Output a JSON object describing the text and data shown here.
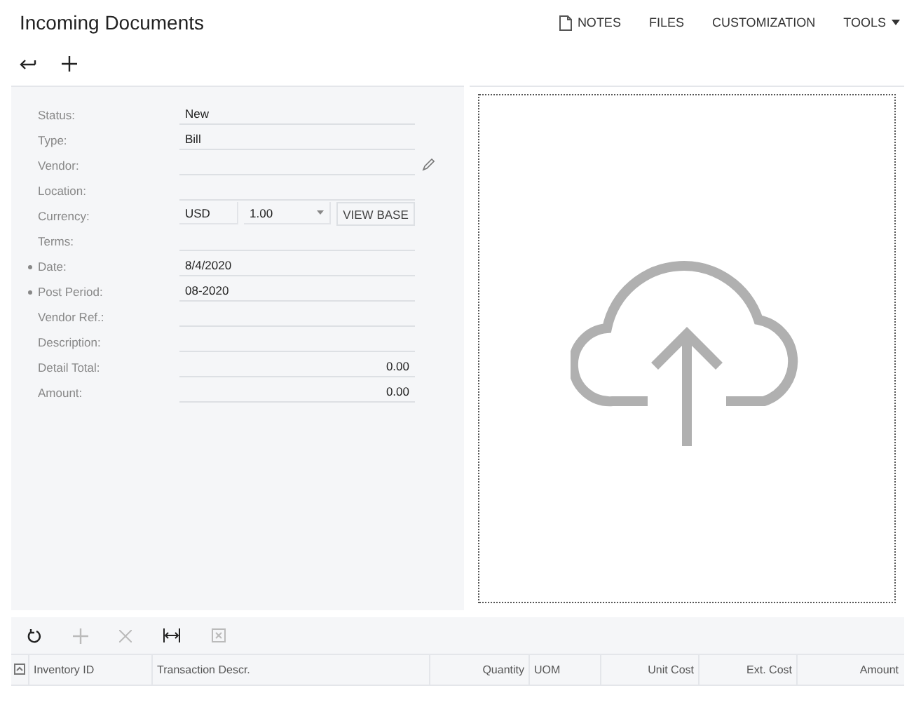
{
  "header": {
    "title": "Incoming Documents",
    "actions": [
      {
        "label": "NOTES",
        "kind": "notes"
      },
      {
        "label": "FILES",
        "kind": "plain"
      },
      {
        "label": "CUSTOMIZATION",
        "kind": "plain"
      },
      {
        "label": "TOOLS",
        "kind": "menu"
      }
    ]
  },
  "toolbar": [
    {
      "kind": "back"
    },
    {
      "kind": "add"
    }
  ],
  "form": [
    {
      "label": "Status:",
      "value": "New",
      "kind": "text",
      "required": false
    },
    {
      "label": "Type:",
      "value": "Bill",
      "kind": "text",
      "required": false
    },
    {
      "label": "Vendor:",
      "kind": "edit",
      "required": false
    },
    {
      "label": "Location:",
      "kind": "text",
      "required": false
    },
    {
      "label": "Currency:",
      "kind": "currency",
      "value": "USD",
      "rate": "1.00",
      "button": "VIEW BASE",
      "required": false
    },
    {
      "label": "Terms:",
      "kind": "text",
      "required": false
    },
    {
      "label": "Date:",
      "value": "8/4/2020",
      "kind": "text",
      "required": true
    },
    {
      "label": "Post Period:",
      "value": "08-2020",
      "kind": "text",
      "required": true
    },
    {
      "label": "Vendor Ref.:",
      "kind": "text",
      "required": false
    },
    {
      "label": "Description:",
      "kind": "text",
      "required": false
    },
    {
      "label": "Detail Total:",
      "value": "0.00",
      "kind": "amount",
      "required": false
    },
    {
      "label": "Amount:",
      "value": "0.00",
      "kind": "amount",
      "required": false
    }
  ],
  "grid": {
    "tools": [
      {
        "kind": "refresh",
        "disabled": false
      },
      {
        "kind": "add",
        "disabled": true
      },
      {
        "kind": "delete",
        "disabled": true
      },
      {
        "kind": "fit",
        "disabled": false
      },
      {
        "kind": "excel",
        "disabled": true
      }
    ],
    "columns": [
      {
        "label": "Inventory ID",
        "kind": "text"
      },
      {
        "label": "Transaction Descr.",
        "kind": "text"
      },
      {
        "label": "Quantity",
        "kind": "number"
      },
      {
        "label": "UOM",
        "kind": "text"
      },
      {
        "label": "Unit Cost",
        "kind": "number"
      },
      {
        "label": "Ext. Cost",
        "kind": "number"
      },
      {
        "label": "Amount",
        "kind": "number"
      }
    ]
  }
}
